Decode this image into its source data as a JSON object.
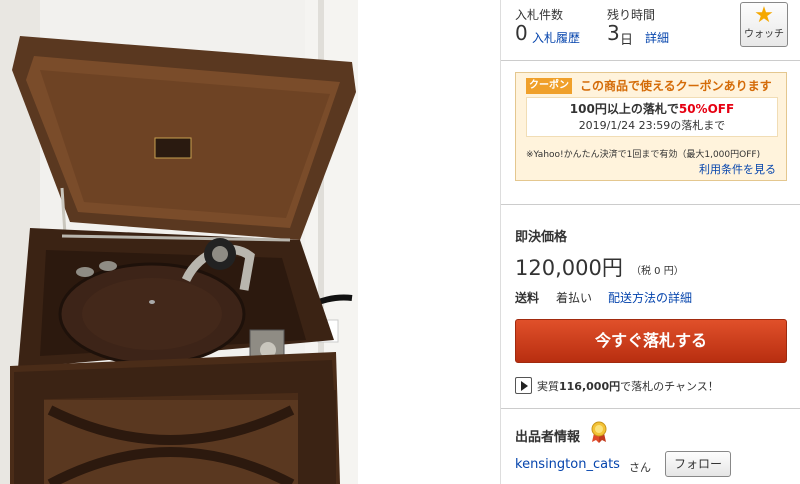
{
  "photo": {
    "alt_icon": "gramophone-photo",
    "colors": {
      "wood_dark": "#3b2314",
      "wood_mid": "#5a3820",
      "wood_light": "#7a4c2a",
      "wall": "#f2f1ee",
      "platter": "#3d2418",
      "metal": "#b9b6ae"
    }
  },
  "stats": {
    "bids_label": "入札件数",
    "bids_value": "0",
    "bids_link": "入札履歴",
    "time_label": "残り時間",
    "time_value": "3",
    "time_unit": "日",
    "time_link": "詳細",
    "watch_label": "ウォッチ",
    "watch_icon": "star-icon"
  },
  "coupon": {
    "tag": "クーポン",
    "title": "この商品で使えるクーポンあります",
    "main_prefix": "100円以上の落札で",
    "main_highlight": "50%OFF",
    "deadline": "2019/1/24 23:59の落札まで",
    "note": "※Yahoo!かんたん決済で1回まで有効（最大1,000円OFF)",
    "link": "利用条件を見る",
    "colors": {
      "accent": "#f0a02a",
      "title": "#d46b08",
      "bg": "#fff3dc",
      "red": "#e60012"
    }
  },
  "buy": {
    "title": "即決価格",
    "price": "120,000円",
    "tax": "（税 0 円）",
    "ship_label": "送料",
    "ship_value": "着払い",
    "ship_link": "配送方法の詳細",
    "bid_button": "今すぐ落札する",
    "chance_prefix": "実質",
    "chance_amount": "116,000円",
    "chance_suffix": "で落札のチャンス！",
    "colors": {
      "button": "#c8381a",
      "link": "#0645ad"
    }
  },
  "seller": {
    "title": "出品者情報",
    "medal_icon": "medal-icon",
    "name": "kensington_cats",
    "suffix": "さん",
    "follow": "フォロー"
  }
}
